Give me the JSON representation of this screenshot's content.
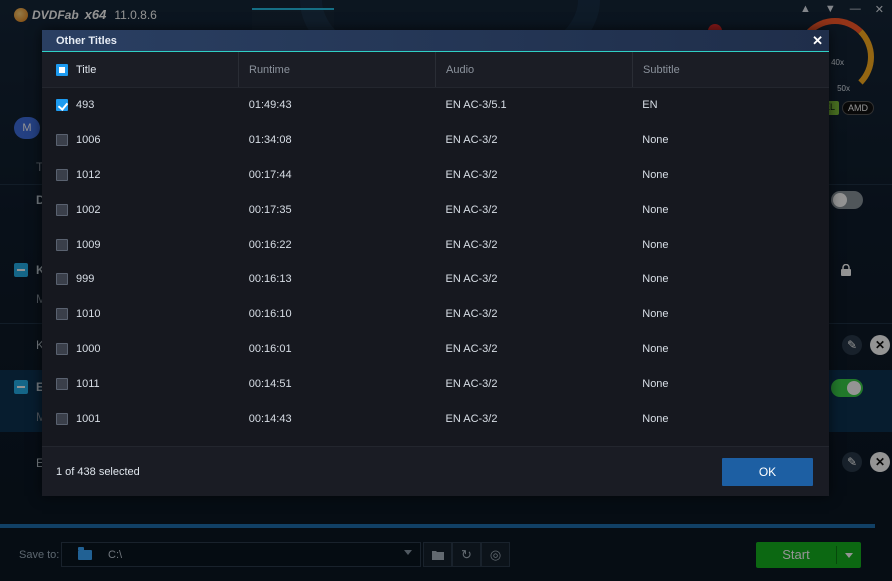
{
  "app": {
    "brand": "DVDFab",
    "arch": "x64",
    "version": "11.0.8.6",
    "gauge_labels": [
      "40x",
      "50x"
    ],
    "chips": [
      "EL",
      "AMD"
    ],
    "mode_label": "M"
  },
  "background": {
    "letters": [
      "T",
      "D",
      "K",
      "M",
      "K",
      "E",
      "M",
      "E"
    ]
  },
  "modal": {
    "title": "Other Titles",
    "columns": [
      "Title",
      "Runtime",
      "Audio",
      "Subtitle"
    ],
    "rows": [
      {
        "title": "493",
        "runtime": "01:49:43",
        "audio": "EN AC-3/5.1",
        "subtitle": "EN",
        "checked": true
      },
      {
        "title": "1006",
        "runtime": "01:34:08",
        "audio": "EN AC-3/2",
        "subtitle": "None",
        "checked": false
      },
      {
        "title": "1012",
        "runtime": "00:17:44",
        "audio": "EN AC-3/2",
        "subtitle": "None",
        "checked": false
      },
      {
        "title": "1002",
        "runtime": "00:17:35",
        "audio": "EN AC-3/2",
        "subtitle": "None",
        "checked": false
      },
      {
        "title": "1009",
        "runtime": "00:16:22",
        "audio": "EN AC-3/2",
        "subtitle": "None",
        "checked": false
      },
      {
        "title": "999",
        "runtime": "00:16:13",
        "audio": "EN AC-3/2",
        "subtitle": "None",
        "checked": false
      },
      {
        "title": "1010",
        "runtime": "00:16:10",
        "audio": "EN AC-3/2",
        "subtitle": "None",
        "checked": false
      },
      {
        "title": "1000",
        "runtime": "00:16:01",
        "audio": "EN AC-3/2",
        "subtitle": "None",
        "checked": false
      },
      {
        "title": "1011",
        "runtime": "00:14:51",
        "audio": "EN AC-3/2",
        "subtitle": "None",
        "checked": false
      },
      {
        "title": "1001",
        "runtime": "00:14:43",
        "audio": "EN AC-3/2",
        "subtitle": "None",
        "checked": false
      }
    ],
    "selected_text": "1 of 438 selected",
    "ok_label": "OK"
  },
  "bottom": {
    "save_label": "Save to:",
    "path": "C:\\",
    "start_label": "Start"
  }
}
